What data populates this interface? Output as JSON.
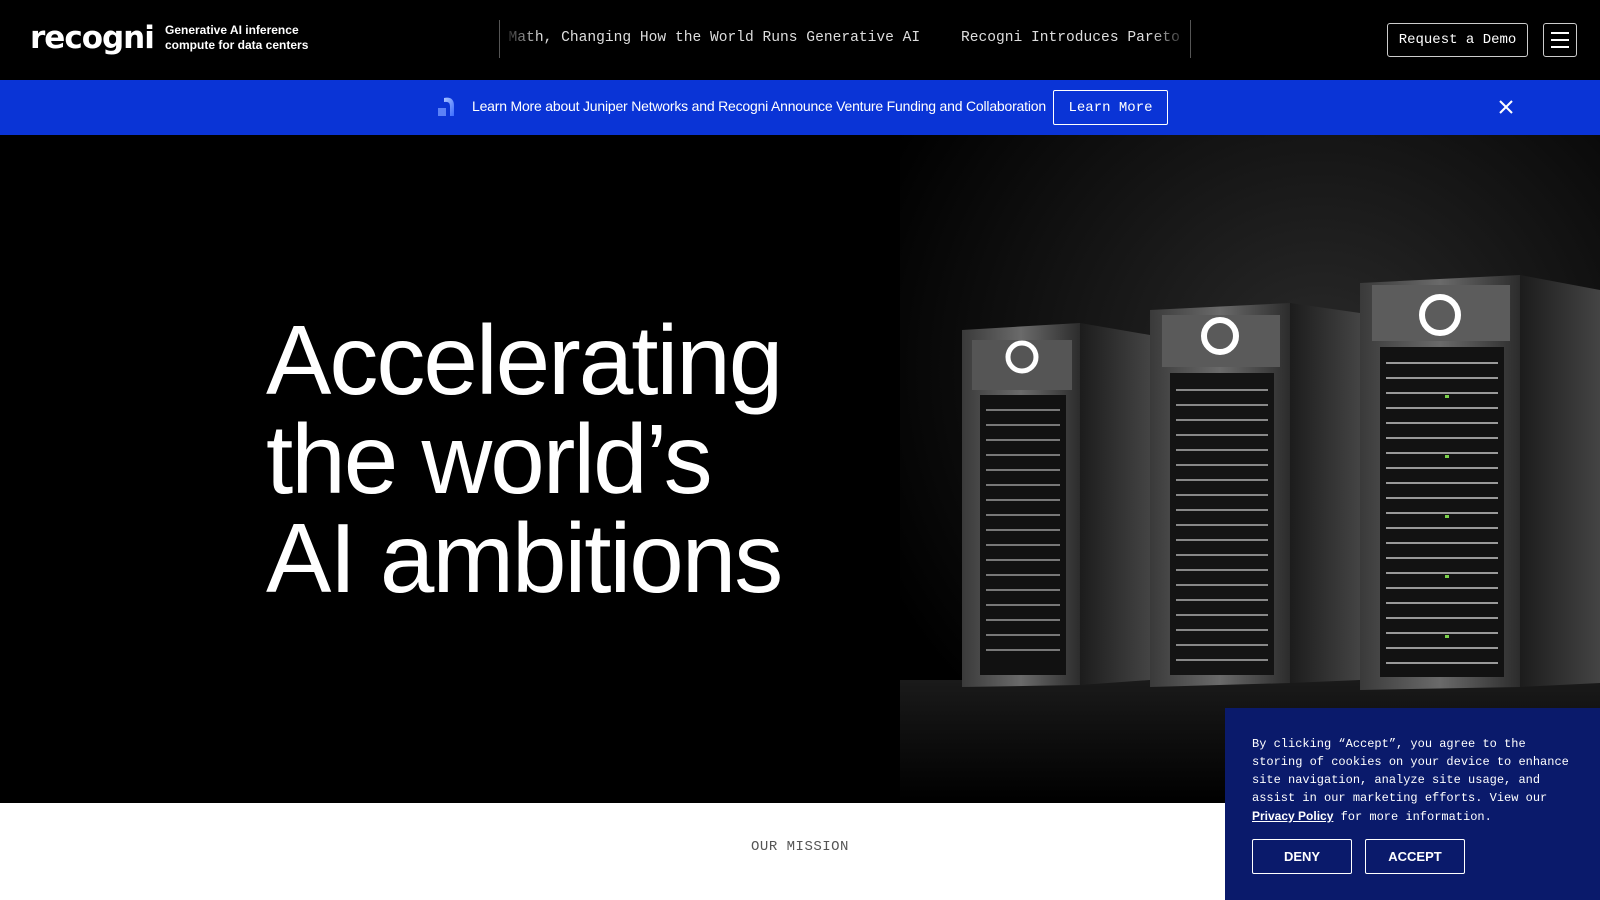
{
  "nav": {
    "logo_text": "recogni",
    "tagline": "Generative AI inference compute for data centers",
    "ticker_items": [
      "to AI Math, Changing How the World Runs Generative AI",
      "Recogni Introduces Pareto"
    ],
    "demo_label": "Request a Demo"
  },
  "banner": {
    "text": "Learn More about Juniper Networks and Recogni Announce Venture Funding and Collaboration",
    "button_label": "Learn More",
    "color": "#0a34d6"
  },
  "hero": {
    "title_lines": [
      "Accelerating",
      "the world’s",
      "AI ambitions"
    ]
  },
  "mission": {
    "label": "OUR MISSION"
  },
  "cookie": {
    "text_before": "By clicking “Accept”, you agree to the storing of cookies on your device to enhance site navigation, analyze site usage, and assist in our marketing efforts. View our ",
    "link_text": "Privacy Policy",
    "text_after": " for more information.",
    "deny_label": "DENY",
    "accept_label": "ACCEPT",
    "color": "#0a1a6b"
  }
}
